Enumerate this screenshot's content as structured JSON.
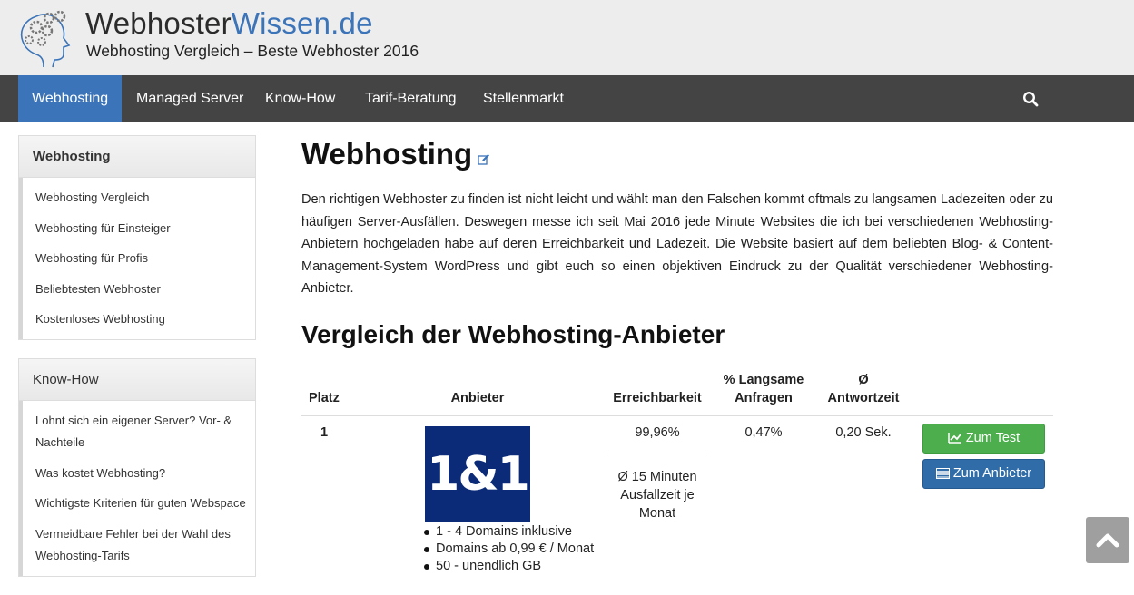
{
  "header": {
    "site_name_main": "Webhoster",
    "site_name_accent": "Wissen.de",
    "tagline": "Webhosting Vergleich – Beste Webhoster 2016",
    "accent_color": "#3b74b8"
  },
  "nav": {
    "items": [
      {
        "label": "Webhosting",
        "active": true
      },
      {
        "label": "Managed Server"
      },
      {
        "label": "Know-How"
      },
      {
        "label": "Tarif-Beratung"
      },
      {
        "label": "Stellenmarkt"
      }
    ],
    "search_icon": "search-icon"
  },
  "sidebar": {
    "panels": [
      {
        "title": "Webhosting",
        "items": [
          "Webhosting Vergleich",
          "Webhosting für Einsteiger",
          "Webhosting für Profis",
          "Beliebtesten Webhoster",
          "Kostenloses Webhosting"
        ]
      },
      {
        "title": "Know-How",
        "items": [
          "Lohnt sich ein eigener Server? Vor- & Nachteile",
          "Was kostet Webhosting?",
          "Wichtigste Kriterien für guten Webspace",
          "Vermeidbare Fehler bei der Wahl des Webhosting-Tarifs"
        ]
      }
    ]
  },
  "main": {
    "title": "Webhosting",
    "intro": "Den richtigen Webhoster zu finden ist nicht leicht und wählt man den Falschen kommt oftmals zu langsamen Ladezeiten oder zu häufigen Server-Ausfällen. Deswegen messe ich seit Mai 2016 jede Minute Websites die ich bei verschiedenen Webhosting-Anbietern hochgeladen habe auf deren Erreichbarkeit und Ladezeit. Die Website basiert auf dem beliebten Blog- & Content-Management-System WordPress und gibt euch so einen objektiven Eindruck zu der Qualität verschiedener Webhosting-Anbieter.",
    "subtitle": "Vergleich der Webhosting-Anbieter",
    "table": {
      "headers": {
        "rank": "Platz",
        "provider": "Anbieter",
        "availability": "Erreichbarkeit",
        "slow": "% Langsame Anfragen",
        "response": "Ø Antwortzeit"
      },
      "rows": [
        {
          "rank": "1",
          "logo_text": "1&1",
          "logo_color": "#0b2a77",
          "features": [
            "1 - 4 Domains inklusive",
            "Domains ab 0,99 € / Monat",
            "50 - unendlich GB"
          ],
          "availability": "99,96%",
          "downtime": "Ø 15 Minuten Ausfallzeit je Monat",
          "slow": "0,47%",
          "response": "0,20 Sek.",
          "btn_test": "Zum Test",
          "btn_provider": "Zum Anbieter"
        }
      ]
    }
  }
}
